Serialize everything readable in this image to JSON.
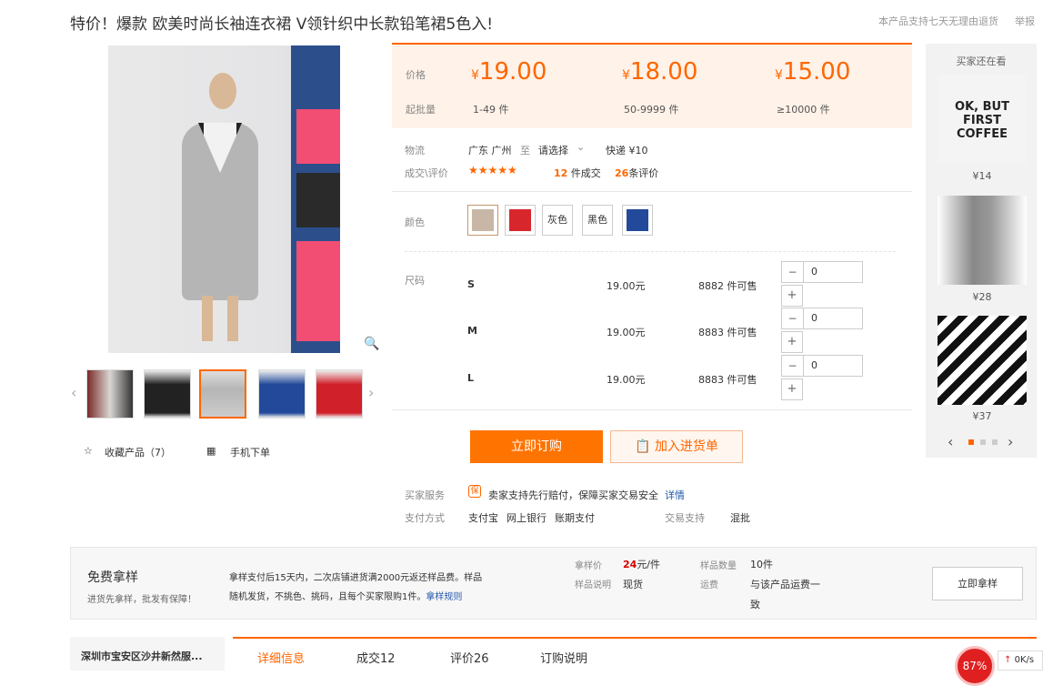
{
  "title": "特价！爆款 欧美时尚长袖连衣裙 V领针织中长款铅笔裙5色入!",
  "header": {
    "policy": "本产品支持七天无理由退货",
    "report": "举报"
  },
  "price_tiers": {
    "label_price": "价格",
    "label_qty": "起批量",
    "currency": "¥",
    "tiers": [
      {
        "price": "19.00",
        "qty": "1-49 件"
      },
      {
        "price": "18.00",
        "qty": "50-9999 件"
      },
      {
        "price": "15.00",
        "qty": "≥10000 件"
      }
    ]
  },
  "logistics": {
    "label": "物流",
    "from": "广东 广州",
    "to": "至",
    "select": "请选择",
    "fee": "快递 ¥10"
  },
  "deals": {
    "label": "成交\\评价",
    "stars": "★★★★★",
    "count": "12",
    "count_suffix": "件成交",
    "reviews": "26",
    "reviews_suffix": "条评价"
  },
  "colors": {
    "label": "颜色",
    "options": [
      "灰色",
      "黑色"
    ]
  },
  "sizes": {
    "label": "尺码",
    "rows": [
      {
        "size": "S",
        "price": "19.00元",
        "stock": "8882 件可售",
        "qty": "0"
      },
      {
        "size": "M",
        "price": "19.00元",
        "stock": "8883 件可售",
        "qty": "0"
      },
      {
        "size": "L",
        "price": "19.00元",
        "stock": "8883 件可售",
        "qty": "0"
      }
    ]
  },
  "buttons": {
    "buy": "立即订购",
    "cart": "加入进货单"
  },
  "service": {
    "label": "买家服务",
    "text": "卖家支持先行赔付，保障买家交易安全",
    "link": "详情"
  },
  "payment": {
    "label": "支付方式",
    "methods": [
      "支付宝",
      "网上银行",
      "账期支付"
    ],
    "trade_label": "交易支持",
    "trade_value": "混批"
  },
  "gallery": {
    "fav": "收藏产品（7）",
    "mobile": "手机下单"
  },
  "side": {
    "title": "买家还在看",
    "items": [
      {
        "price": "¥14",
        "text": "OK, BUT FIRST COFFEE"
      },
      {
        "price": "¥28"
      },
      {
        "price": "¥37"
      }
    ]
  },
  "sample": {
    "title": "免费拿样",
    "subtitle": "进货先拿样，批发有保障！",
    "desc1": "拿样支付后15天内，二次店铺进货满2000元返还样品费。样品",
    "desc2": "随机发货，不挑色、挑码，且每个买家限购1件。",
    "rules": "拿样规则",
    "price_label": "拿样价",
    "price": "24",
    "price_unit": "元/件",
    "count_label": "样品数量",
    "count": "10件",
    "note_label": "样品说明",
    "note": "现货",
    "ship_label": "运费",
    "ship": "与该产品运费一",
    "ship2": "致",
    "button": "立即拿样"
  },
  "tabs": [
    "详细信息",
    "成交12",
    "评价26",
    "订购说明"
  ],
  "shop": "深圳市宝安区沙井新然服...",
  "widget": {
    "percent": "87%",
    "speed": "0K/s"
  }
}
